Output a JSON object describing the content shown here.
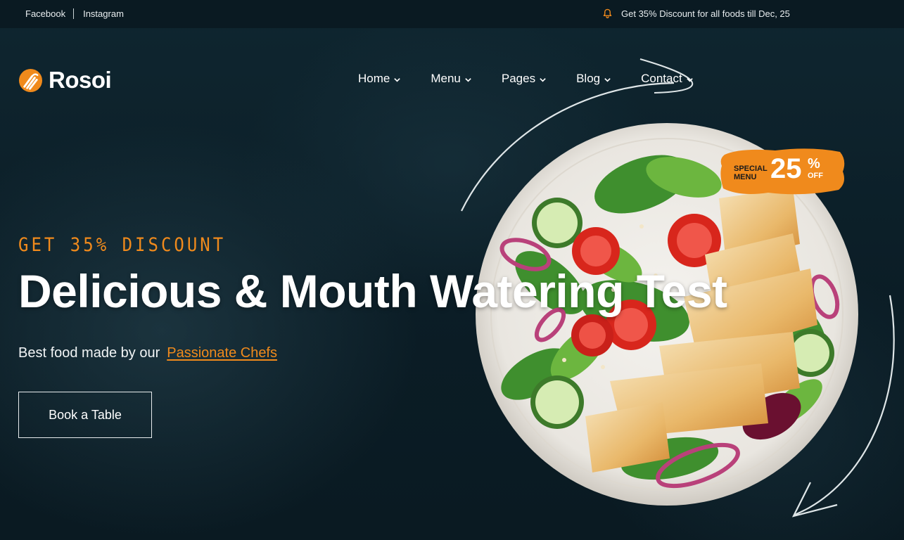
{
  "topbar": {
    "social": [
      "Facebook",
      "Instagram"
    ],
    "promo_text": "Get 35% Discount for all foods till Dec, 25",
    "promo_icon": "bell-icon"
  },
  "brand": {
    "name": "Rosoi",
    "accent": "#f08a1c"
  },
  "nav": [
    {
      "label": "Home"
    },
    {
      "label": "Menu"
    },
    {
      "label": "Pages"
    },
    {
      "label": "Blog"
    },
    {
      "label": "Contact"
    }
  ],
  "badge": {
    "top": "SPECIAL MENU",
    "value": "25",
    "percent": "%",
    "suffix": "OFF"
  },
  "hero": {
    "kicker": "GET 35% DISCOUNT",
    "headline": "Delicious & Mouth Watering Test",
    "sub_text": "Best food made by our",
    "sub_link": "Passionate Chefs",
    "button": "Book a Table"
  },
  "colors": {
    "background": "#0c1f28",
    "accent": "#f08a1c",
    "text": "#ffffff"
  }
}
